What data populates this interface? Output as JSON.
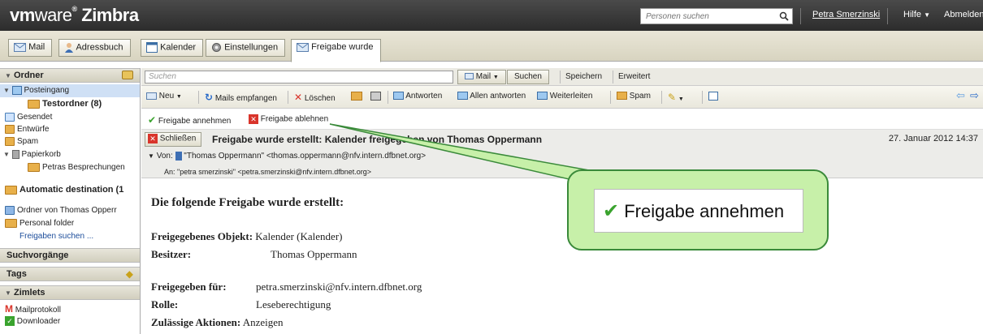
{
  "header": {
    "brand_vm": "vm",
    "brand_ware": "ware",
    "brand_app": "Zimbra",
    "person_search_placeholder": "Personen suchen",
    "user_name": "Petra Smerzinski",
    "help_label": "Hilfe",
    "logout_label": "Abmelden"
  },
  "tabs": [
    {
      "label": "Mail",
      "icon": "mail-icon"
    },
    {
      "label": "Adressbuch",
      "icon": "contacts-icon"
    },
    {
      "label": "Kalender",
      "icon": "calendar-icon"
    },
    {
      "label": "Einstellungen",
      "icon": "settings-icon"
    },
    {
      "label": "Freigabe wurde",
      "icon": "mail-icon",
      "active": true
    }
  ],
  "sidebar": {
    "folders_header": "Ordner",
    "items": [
      "Posteingang",
      "Testordner (8)",
      "Gesendet",
      "Entwürfe",
      "Spam",
      "Papierkorb",
      "Petras Besprechungen",
      "Automatic destination (1",
      "Ordner von Thomas Opperr",
      "Personal folder",
      "Freigaben suchen ..."
    ],
    "searches_header": "Suchvorgänge",
    "tags_header": "Tags",
    "zimlets_header": "Zimlets",
    "zimlets": [
      "Mailprotokoll",
      "Downloader"
    ]
  },
  "searchbar": {
    "placeholder": "Suchen",
    "type_label": "Mail",
    "search_button": "Suchen",
    "save_button": "Speichern",
    "advanced_button": "Erweitert"
  },
  "toolbar": {
    "new": "Neu",
    "get_mail": "Mails empfangen",
    "delete": "Löschen",
    "reply": "Antworten",
    "reply_all": "Allen antworten",
    "forward": "Weiterleiten",
    "spam": "Spam"
  },
  "share_actions": {
    "accept": "Freigabe annehmen",
    "decline": "Freigabe ablehnen"
  },
  "message": {
    "close": "Schließen",
    "subject": "Freigabe wurde erstellt: Kalender freigegeben von Thomas Oppermann",
    "date": "27. Januar 2012 14:37",
    "from_label": "Von:",
    "from": "\"Thomas Oppermann\" <thomas.oppermann@nfv.intern.dfbnet.org>",
    "to_label": "An:",
    "to": "\"petra smerzinski\" <petra.smerzinski@nfv.intern.dfbnet.org>"
  },
  "body": {
    "title": "Die folgende Freigabe wurde erstellt:",
    "object_label": "Freigegebenes Objekt:",
    "object_value": "Kalender (Kalender)",
    "owner_label": "Besitzer:",
    "owner_value": "Thomas Oppermann",
    "shared_for_label": "Freigegeben für:",
    "shared_for_value": "petra.smerzinski@nfv.intern.dfbnet.org",
    "role_label": "Rolle:",
    "role_value": "Leseberechtigung",
    "actions_label": "Zulässige Aktionen:",
    "actions_value": "Anzeigen"
  },
  "callout": {
    "text": "Freigabe annehmen"
  },
  "colors": {
    "header_bg": "#333333",
    "callout_fill": "#c7f0a9",
    "callout_border": "#3a8a3a",
    "accept_green": "#3aa32e",
    "decline_red": "#d9342b"
  }
}
